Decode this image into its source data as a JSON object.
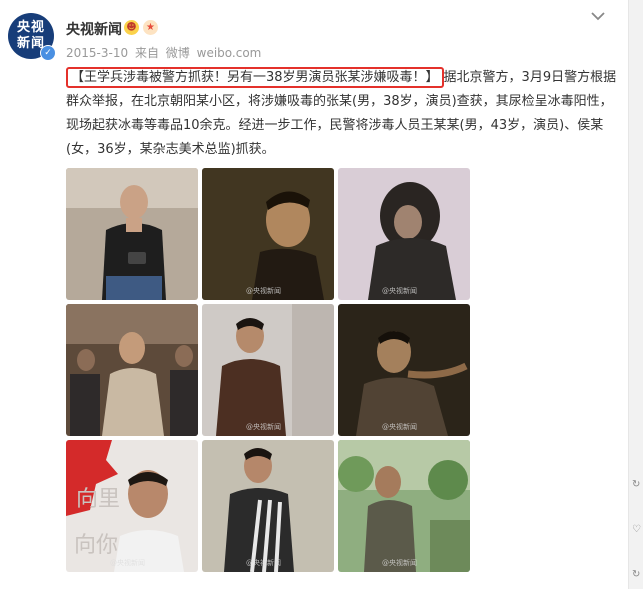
{
  "post": {
    "avatar_line1": "央视",
    "avatar_line2": "新闻",
    "verified_icon": "verified-check-icon",
    "user_name": "央视新闻",
    "badges": [
      "emoji-face-icon",
      "emoji-star-icon"
    ],
    "date": "2015-3-10",
    "source_prefix": "来自",
    "source_app": "微博",
    "source_domain": "weibo.com",
    "highlight_text": "【王学兵涉毒被警方抓获！另有一38岁男演员张某涉嫌吸毒！】",
    "body_text": "据北京警方，3月9日警方根据群众举报，在北京朝阳某小区，将涉嫌吸毒的张某(男，38岁，演员)查获，其尿检呈冰毒阳性，现场起获冰毒等毒品10余克。经进一步工作，民警将涉毒人员王某某(男，43岁，演员)、侯某(女，36岁，某杂志美术总监)抓获。",
    "watermark": "@央视新闻"
  },
  "photos": [
    {
      "label": "photo-1"
    },
    {
      "label": "photo-2"
    },
    {
      "label": "photo-3"
    },
    {
      "label": "photo-4"
    },
    {
      "label": "photo-5"
    },
    {
      "label": "photo-6"
    },
    {
      "label": "photo-7"
    },
    {
      "label": "photo-8"
    },
    {
      "label": "photo-9"
    }
  ],
  "colors": {
    "highlight_border": "#e4312b",
    "avatar_bg": "#173d79",
    "verified": "#4a90e2"
  }
}
